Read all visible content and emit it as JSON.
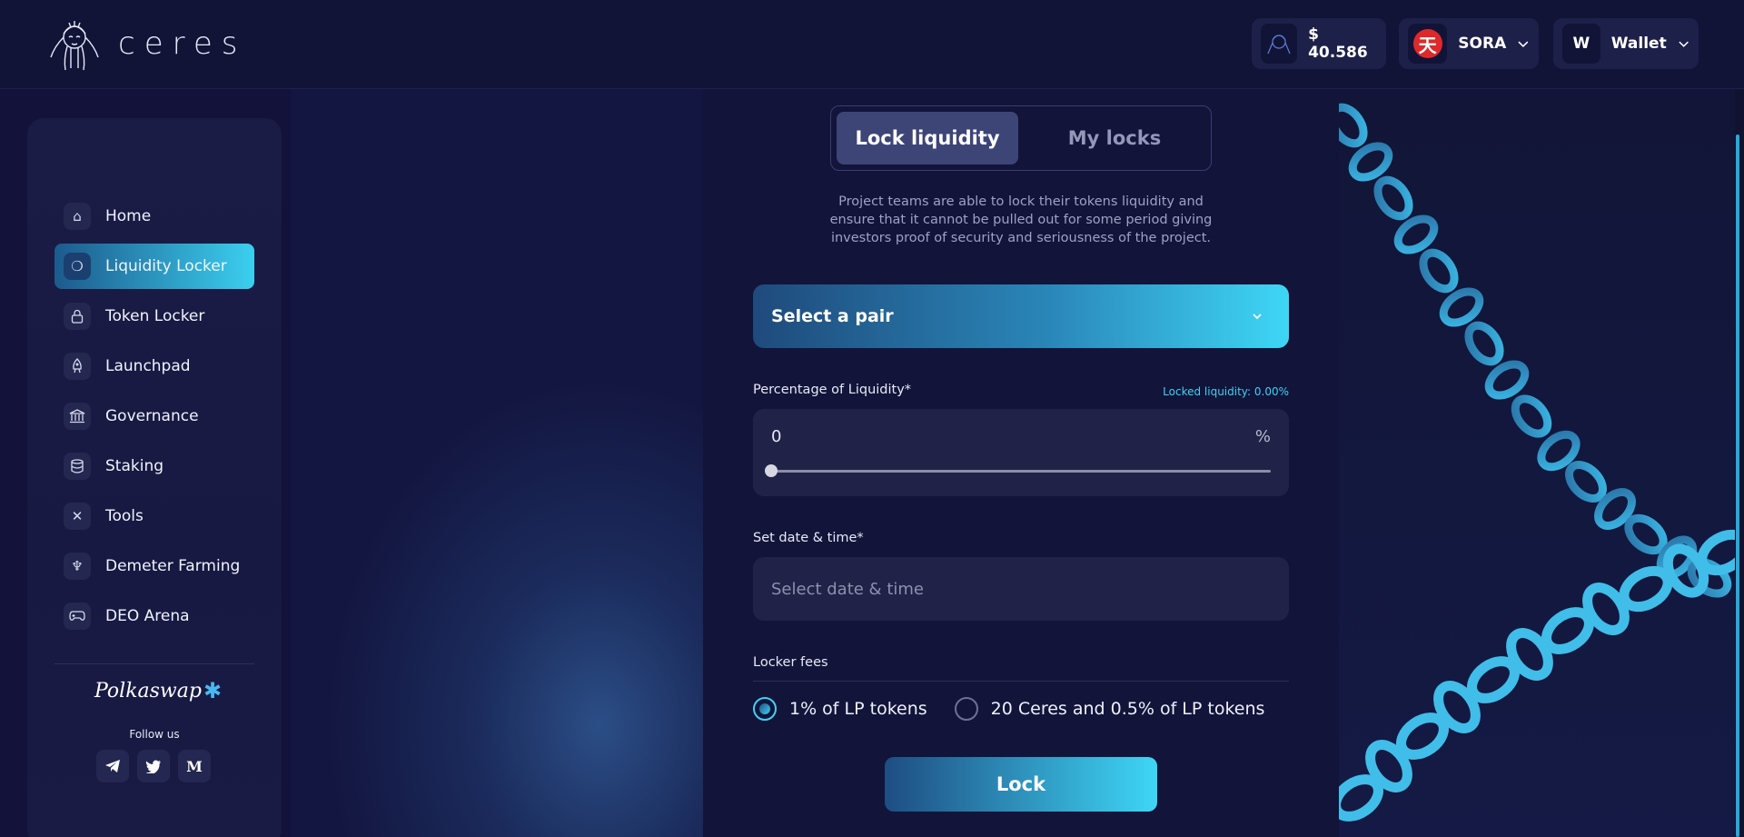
{
  "header": {
    "brand": "ceres",
    "price": {
      "currency": "$",
      "value": "40.586"
    },
    "network": {
      "label": "SORA",
      "icon": "sora-logo-icon"
    },
    "wallet": {
      "initial": "W",
      "label": "Wallet"
    }
  },
  "sidebar": {
    "items": [
      {
        "label": "Home",
        "icon": "home-icon"
      },
      {
        "label": "Liquidity Locker",
        "icon": "liquidity-locker-icon",
        "active": true
      },
      {
        "label": "Token Locker",
        "icon": "lock-icon"
      },
      {
        "label": "Launchpad",
        "icon": "rocket-icon"
      },
      {
        "label": "Governance",
        "icon": "bank-icon"
      },
      {
        "label": "Staking",
        "icon": "database-icon"
      },
      {
        "label": "Tools",
        "icon": "tools-icon"
      },
      {
        "label": "Demeter Farming",
        "icon": "plant-icon"
      },
      {
        "label": "DEO Arena",
        "icon": "gamepad-icon"
      }
    ],
    "partner": "Polkaswap",
    "follow_label": "Follow us",
    "socials": [
      {
        "name": "telegram-icon",
        "glyph": "✈"
      },
      {
        "name": "twitter-icon",
        "glyph": "🐦"
      },
      {
        "name": "medium-icon",
        "glyph": "M"
      }
    ]
  },
  "main": {
    "tabs": [
      {
        "label": "Lock liquidity",
        "active": true
      },
      {
        "label": "My locks",
        "active": false
      }
    ],
    "description": "Project teams are able to lock their tokens liquidity and ensure that it cannot be pulled out for some period giving investors proof of security and seriousness of the project.",
    "select_pair": "Select a pair",
    "percentage": {
      "label": "Percentage of Liquidity*",
      "locked_info": "Locked liquidity: 0.00%",
      "value": "0",
      "unit": "%",
      "slider_value": 0
    },
    "date": {
      "label": "Set date & time*",
      "placeholder": "Select date & time"
    },
    "fees": {
      "label": "Locker fees",
      "options": [
        {
          "label": "1% of LP tokens",
          "checked": true
        },
        {
          "label": "20 Ceres and 0.5% of LP tokens",
          "checked": false
        }
      ]
    },
    "lock_button": "Lock"
  },
  "colors": {
    "accent": "#3ed6f6",
    "background": "#12123a",
    "sora_red": "#e0282b"
  }
}
